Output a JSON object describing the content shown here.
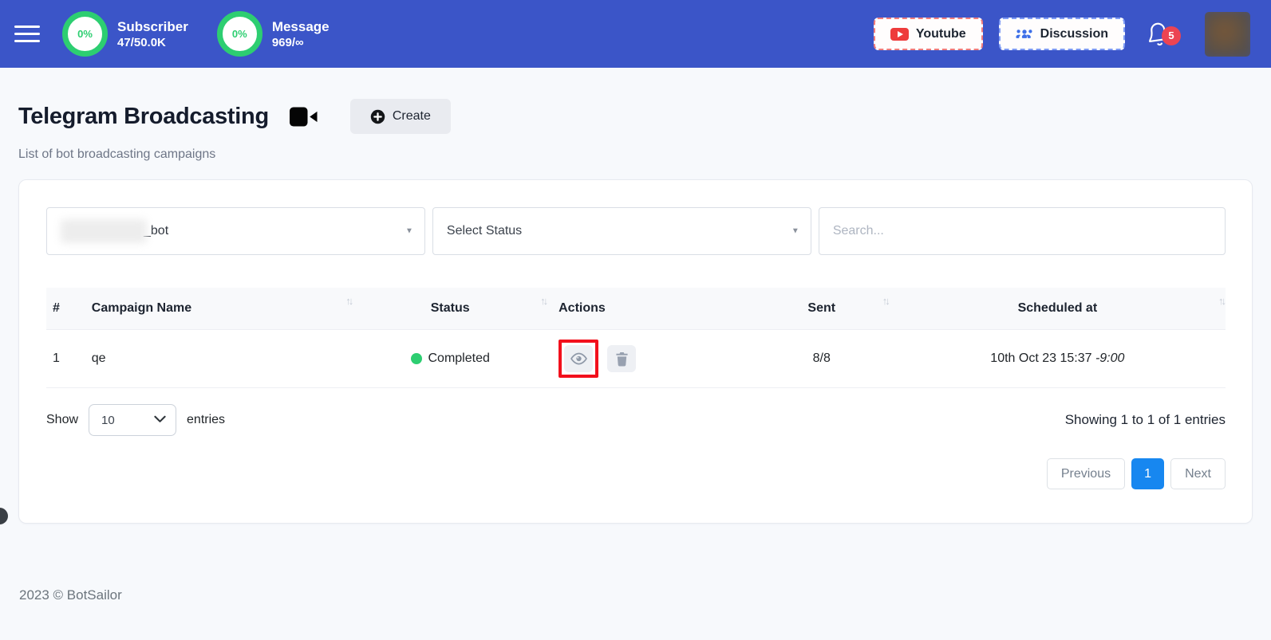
{
  "navbar": {
    "stats": [
      {
        "percent": "0%",
        "label": "Subscriber",
        "value": "47/50.0K"
      },
      {
        "percent": "0%",
        "label": "Message",
        "value": "969/∞"
      }
    ],
    "youtube_label": "Youtube",
    "discussion_label": "Discussion",
    "notification_count": "5"
  },
  "page": {
    "title": "Telegram Broadcasting",
    "create_label": "Create",
    "subtitle": "List of bot broadcasting campaigns"
  },
  "filters": {
    "bot_select_value": "_bot",
    "status_select_value": "Select Status",
    "search_placeholder": "Search..."
  },
  "icons": {
    "sort": "↑↓",
    "caret": "▼"
  },
  "table": {
    "columns": [
      "#",
      "Campaign Name",
      "Status",
      "Actions",
      "Sent",
      "Scheduled at"
    ],
    "rows": [
      {
        "index": "1",
        "name": "qe",
        "status": "Completed",
        "sent": "8/8",
        "scheduled": "10th Oct 23 15:37 ",
        "scheduled_offset": "-9:00"
      }
    ]
  },
  "pagination": {
    "show_label": "Show",
    "per_page": "10",
    "entries_label": "entries",
    "summary": "Showing 1 to 1 of 1 entries",
    "previous_label": "Previous",
    "current_page": "1",
    "next_label": "Next"
  },
  "footer": {
    "copyright": "2023 © BotSailor"
  },
  "colors": {
    "navbar_blue": "#3b55c8",
    "progress_green": "#2dce71",
    "badge_red": "#ec4453",
    "youtube_red": "#ee3b3b",
    "discussion_blue": "#3d6fe8",
    "pagination_blue": "#1787f0",
    "annotation_red": "#f2101c"
  }
}
